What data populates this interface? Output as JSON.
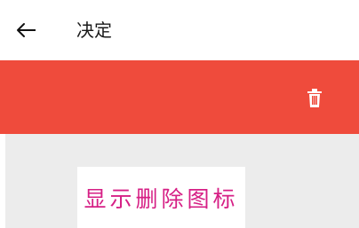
{
  "header": {
    "back_icon": "arrow-left-icon",
    "title": "决定"
  },
  "toolbar": {
    "background": "#ef4b3c",
    "delete_icon": "trash-icon"
  },
  "content": {
    "background": "#ececec",
    "label_text": "显示删除图标",
    "label_color": "#d61f85"
  }
}
